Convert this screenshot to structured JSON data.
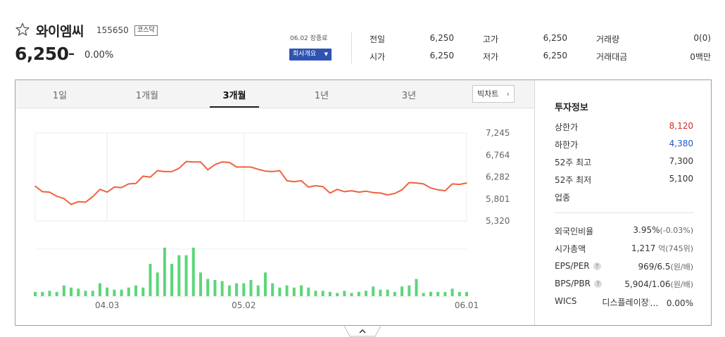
{
  "stock": {
    "name": "와이엠씨",
    "code": "155650",
    "market": "코스닥",
    "price": "6,250",
    "change_mark": "–",
    "change_rate": "0.00%",
    "date_status": "06.02 장종료",
    "profile_button": "회사개요"
  },
  "quote": {
    "prev_close_label": "전일",
    "prev_close": "6,250",
    "open_label": "시가",
    "open": "6,250",
    "high_label": "고가",
    "high": "6,250",
    "low_label": "저가",
    "low": "6,250",
    "volume_label": "거래량",
    "volume": "0(0)",
    "amount_label": "거래대금",
    "amount": "0백만"
  },
  "tabs": [
    {
      "label": "1일",
      "active": false
    },
    {
      "label": "1개월",
      "active": false
    },
    {
      "label": "3개월",
      "active": true
    },
    {
      "label": "1년",
      "active": false
    },
    {
      "label": "3년",
      "active": false
    }
  ],
  "big_chart_button": "빅차트",
  "investment": {
    "title": "투자정보",
    "upper_limit_label": "상한가",
    "upper_limit": "8,120",
    "lower_limit_label": "하한가",
    "lower_limit": "4,380",
    "week52_high_label": "52주 최고",
    "week52_high": "7,300",
    "week52_low_label": "52주 최저",
    "week52_low": "5,100",
    "sector_label": "업종",
    "foreign_ratio_label": "외국인비율",
    "foreign_ratio": "3.95%",
    "foreign_ratio_change": "(-0.03%)",
    "market_cap_label": "시가총액",
    "market_cap": "1,217",
    "market_cap_unit1": "억",
    "market_cap_rank": "(745위)",
    "eps_per_label": "EPS/PER",
    "eps_per": "969/6.5",
    "eps_per_unit": "(원/배)",
    "bps_pbr_label": "BPS/PBR",
    "bps_pbr": "5,904/1.06",
    "bps_pbr_unit": "(원/배)",
    "wics_label": "WICS",
    "wics_value": "디스플레이장비및부품",
    "wics_rate": "0.00%"
  },
  "colors": {
    "line": "#f0623f",
    "volume": "#5cd67a",
    "up": "#d6282b",
    "down": "#2553c9",
    "accent": "#2f53b0"
  },
  "chart_data": {
    "type": "line",
    "title": "",
    "ylim": [
      5320,
      7245
    ],
    "y_ticks": [
      "7,245",
      "6,764",
      "6,282",
      "5,801",
      "5,320"
    ],
    "x_ticks": [
      "04.03",
      "05.02",
      "06.01"
    ],
    "series": [
      {
        "values": [
          6080,
          5960,
          5950,
          5860,
          5810,
          5680,
          5740,
          5730,
          5850,
          6010,
          5950,
          6060,
          6050,
          6130,
          6140,
          6300,
          6280,
          6420,
          6400,
          6400,
          6470,
          6620,
          6610,
          6610,
          6440,
          6550,
          6610,
          6600,
          6500,
          6500,
          6500,
          6450,
          6410,
          6400,
          6420,
          6200,
          6180,
          6200,
          6060,
          6090,
          6070,
          5930,
          6010,
          5960,
          5980,
          5950,
          5970,
          5940,
          5930,
          5890,
          5920,
          6000,
          6160,
          6150,
          6130,
          6040,
          6000,
          5980,
          6130,
          6120,
          6150
        ]
      }
    ],
    "volume": [
      4,
      4,
      5,
      4,
      10,
      8,
      7,
      5,
      5,
      12,
      8,
      6,
      6,
      8,
      10,
      8,
      30,
      22,
      45,
      30,
      38,
      38,
      45,
      22,
      16,
      15,
      14,
      10,
      12,
      12,
      15,
      10,
      22,
      12,
      8,
      10,
      8,
      10,
      8,
      5,
      5,
      4,
      3,
      5,
      3,
      4,
      5,
      9,
      6,
      6,
      4,
      9,
      10,
      16,
      3,
      4,
      4,
      4,
      7,
      4,
      4
    ]
  }
}
